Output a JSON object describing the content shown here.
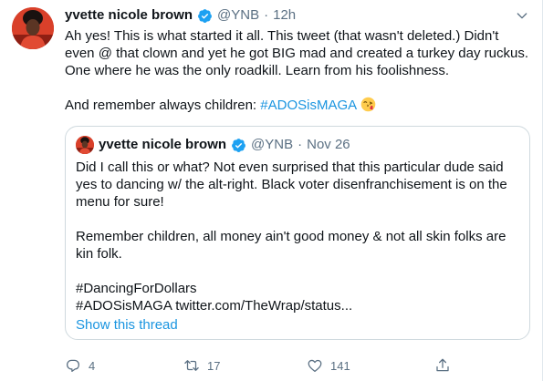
{
  "tweet": {
    "display_name": "yvette nicole brown",
    "handle": "@YNB",
    "separator": "·",
    "time": "12h",
    "text_p1": "Ah yes! This is what started it all. This tweet (that wasn't deleted.) Didn't even @ that clown and yet he got BIG mad and created a turkey day ruckus. One where he was the only roadkill. Learn from his foolishness.",
    "text_p2_prefix": "And remember always children: ",
    "text_p2_hashtag": "#ADOSisMAGA",
    "emoji": "face-blowing-a-kiss"
  },
  "quote": {
    "display_name": "yvette nicole brown",
    "handle": "@YNB",
    "separator": "·",
    "date": "Nov 26",
    "p1": "Did I call this or what? Not even surprised that this particular dude said yes to dancing w/ the alt-right.  Black voter disenfranchisement is on the menu for sure!",
    "p2": "Remember children, all money ain't good money & not all skin folks are kin folk.",
    "p3_line1": "#DancingForDollars",
    "p3_line2": "#ADOSisMAGA twitter.com/TheWrap/status...",
    "show_thread": "Show this thread"
  },
  "actions": {
    "reply_count": "4",
    "retweet_count": "17",
    "like_count": "141"
  },
  "colors": {
    "link": "#1b95e0",
    "muted": "#5b7083",
    "verified": "#1da1f2",
    "border": "#cfd9de"
  }
}
